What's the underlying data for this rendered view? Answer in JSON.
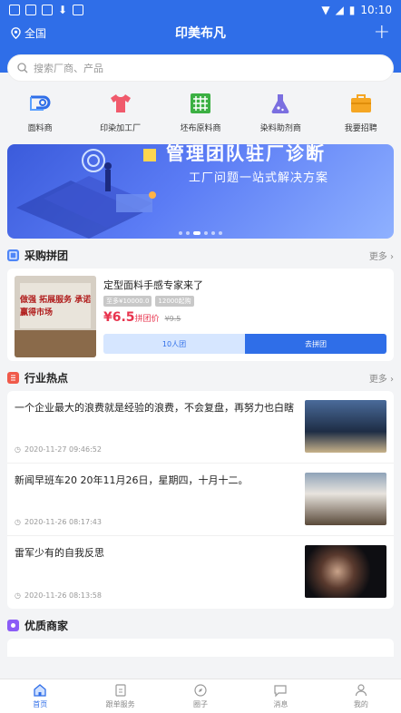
{
  "status_bar": {
    "time": "10:10"
  },
  "header": {
    "location": "全国",
    "title": "印美布凡",
    "add_label": "+"
  },
  "search": {
    "placeholder": "搜索厂商、产品"
  },
  "categories": [
    {
      "label": "面料商",
      "icon": "fabric-icon",
      "color": "#2f6ee8"
    },
    {
      "label": "印染加工厂",
      "icon": "shirt-icon",
      "color": "#f05a6c"
    },
    {
      "label": "坯布原料商",
      "icon": "grid-cloth-icon",
      "color": "#3cb043"
    },
    {
      "label": "染料助剂商",
      "icon": "flask-icon",
      "color": "#7b6fe0"
    },
    {
      "label": "我要招聘",
      "icon": "briefcase-icon",
      "color": "#f5a623"
    }
  ],
  "banner": {
    "title": "管理团队驻厂诊断",
    "subtitle": "工厂问题一站式解决方案",
    "slides": 6,
    "active_slide": 2
  },
  "group_buy": {
    "section_title": "采购拼团",
    "more": "更多",
    "item": {
      "name": "定型面料手感专家来了",
      "tags": [
        "至多¥10000.0",
        "12000起购"
      ],
      "price": "¥6.5",
      "price_suffix": "拼团价",
      "old_price": "¥9.5",
      "group_size": "10人团",
      "action": "去拼团",
      "image_text": "做强 拓展服务 承诺 赢得市场"
    }
  },
  "news": {
    "section_title": "行业热点",
    "more": "更多",
    "items": [
      {
        "title": "一个企业最大的浪费就是经验的浪费，不会复盘，再努力也白瞎",
        "time": "2020-11-27 09:46:52"
      },
      {
        "title": "新闻早班车20  20年11月26日，星期四，十月十二。",
        "time": "2020-11-26 08:17:43"
      },
      {
        "title": "雷军少有的自我反思",
        "time": "2020-11-26 08:13:58"
      }
    ]
  },
  "merchants": {
    "section_title": "优质商家"
  },
  "tabbar": [
    {
      "label": "首页",
      "icon": "home-icon",
      "active": true
    },
    {
      "label": "跟单服务",
      "icon": "clipboard-icon",
      "active": false
    },
    {
      "label": "圈子",
      "icon": "compass-icon",
      "active": false
    },
    {
      "label": "消息",
      "icon": "message-icon",
      "active": false
    },
    {
      "label": "我的",
      "icon": "user-icon",
      "active": false
    }
  ]
}
